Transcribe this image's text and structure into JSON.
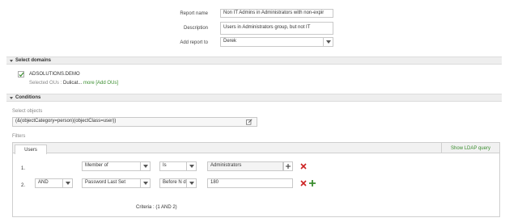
{
  "report": {
    "name_label": "Report name",
    "name_value": "Non IT Admins in Administrators with non-expir",
    "desc_label": "Description",
    "desc_value": "Users in Administrators group, but not IT",
    "addto_label": "Add report to",
    "addto_value": "Derek"
  },
  "domains": {
    "header": "Select domains",
    "domain_name": "ADSOLUTIONS.DEMO",
    "selected_ous_label": "Selected OUs :",
    "selected_ous_value": "Dulicat...",
    "more_link": "more",
    "add_ous_link": "[Add OUs]"
  },
  "conditions": {
    "header": "Conditions",
    "select_objects_label": "Select objects",
    "object_filter": "(&(objectCategory=person)(objectClass=user))",
    "filters_label": "Filters",
    "tab_users": "Users",
    "show_ldap": "Show LDAP query",
    "rows": [
      {
        "num": "1.",
        "logic": "",
        "attribute": "Member of",
        "operator": "Is",
        "value": "Administrators"
      },
      {
        "num": "2.",
        "logic": "AND",
        "attribute": "Password Last Set",
        "operator": "Before N d",
        "value": "180"
      }
    ],
    "criteria_label": "Criteria :",
    "criteria_value": "(1 AND 2)"
  },
  "colors": {
    "accent_green": "#3a8d2f",
    "delete_red": "#cc2222",
    "section_bg": "#eeeeee"
  },
  "icons": {
    "checkbox": "checkbox-checked-icon",
    "edit": "edit-pencil-icon",
    "add": "plus-icon",
    "delete": "close-x-icon",
    "dropdown": "chevron-down-icon"
  }
}
